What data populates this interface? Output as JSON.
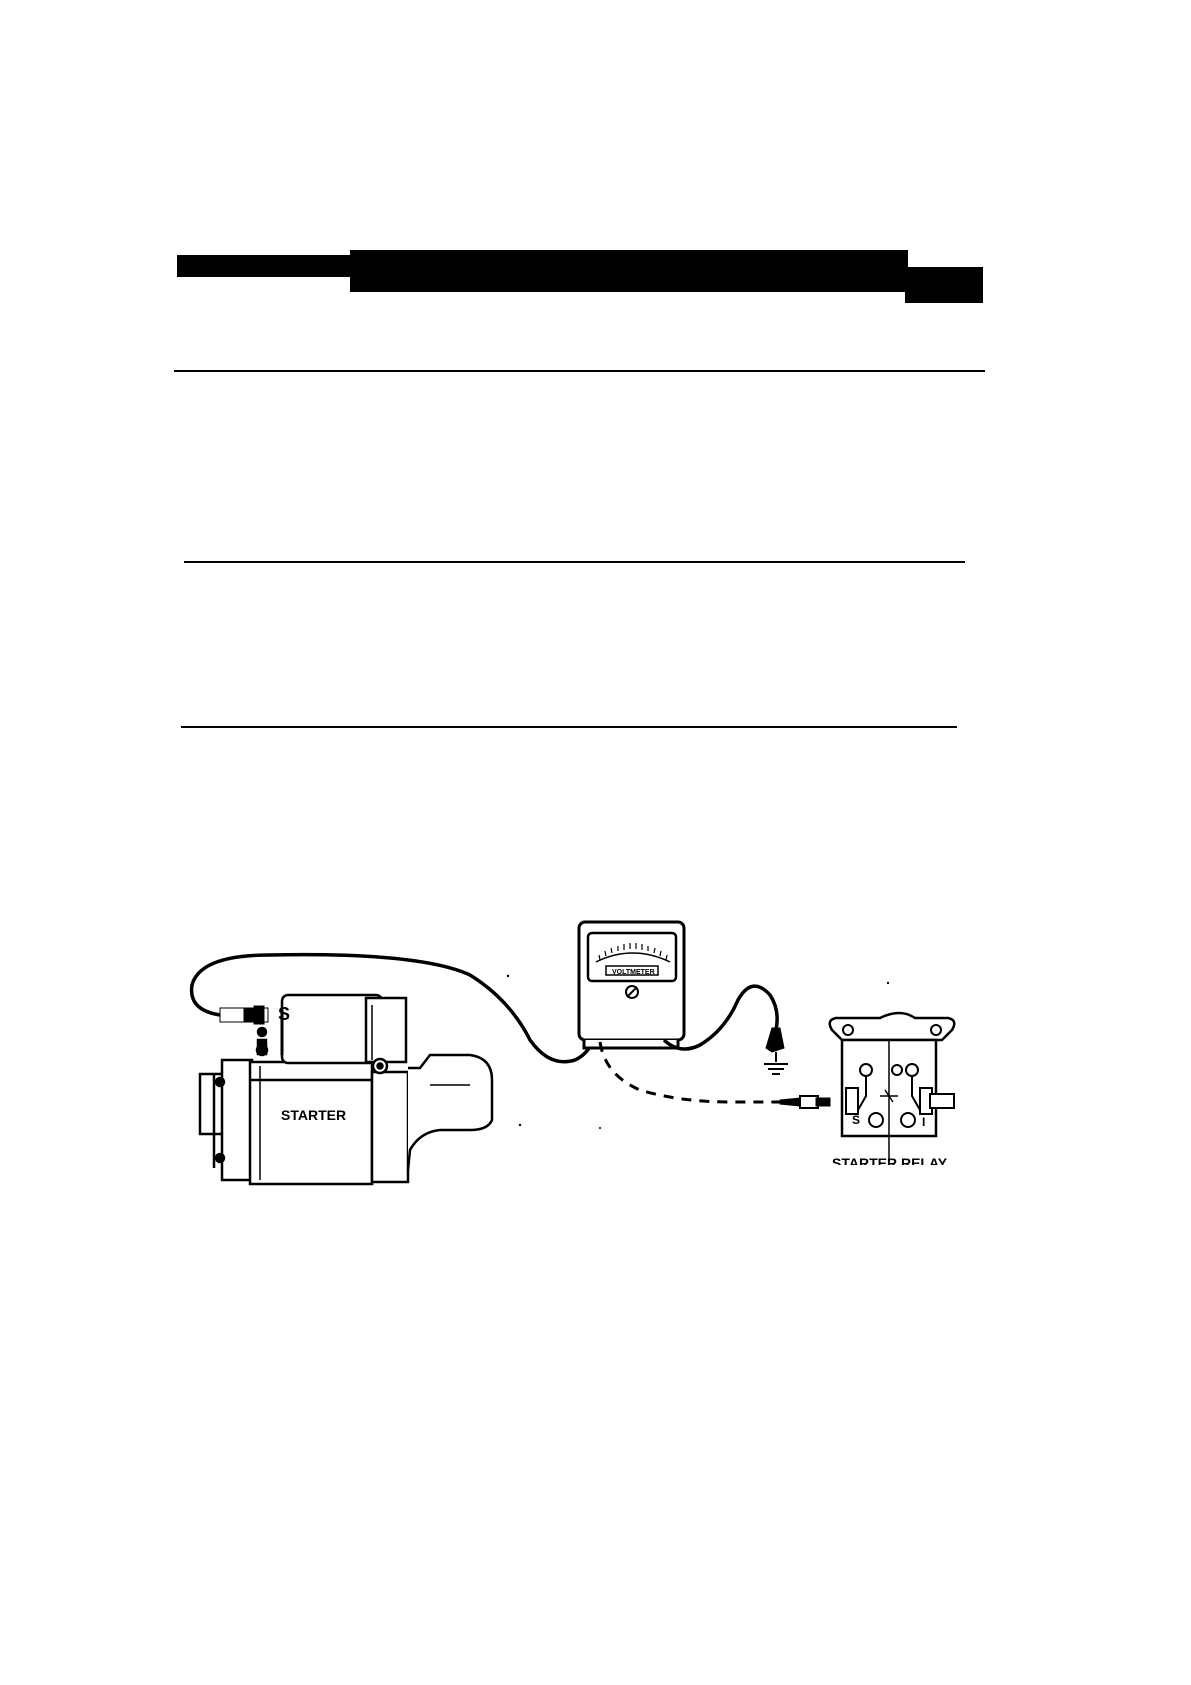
{
  "header": {
    "heading_text": ""
  },
  "diagram": {
    "labels": {
      "starter": "STARTER",
      "voltmeter": "VOLTMETER",
      "starter_relay": "STARTER RELAY",
      "terminal_s_starter": "S",
      "terminal_s_relay": "S",
      "terminal_i_relay": "I"
    },
    "icons": [
      "ground-symbol-icon",
      "zero-adjust-screw-icon"
    ]
  }
}
